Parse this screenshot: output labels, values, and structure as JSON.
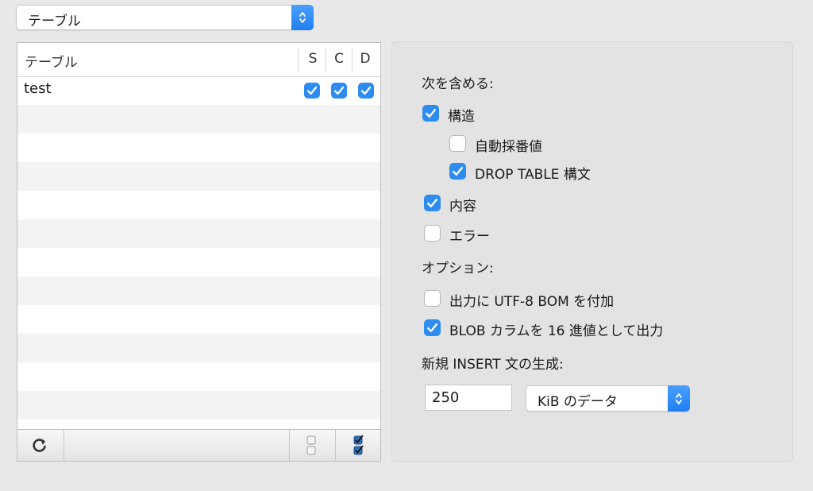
{
  "top_popup": {
    "selected": "テーブル"
  },
  "table": {
    "header_name": "テーブル",
    "col_s": "S",
    "col_c": "C",
    "col_d": "D",
    "rows": [
      {
        "name": "test",
        "s": true,
        "c": true,
        "d": true
      }
    ]
  },
  "options": {
    "include_heading": "次を含める:",
    "structure": "構造",
    "auto_increment": "自動採番値",
    "drop_table": "DROP TABLE 構文",
    "content": "内容",
    "errors": "エラー",
    "options_heading": "オプション:",
    "utf8_bom": "出力に UTF-8 BOM を付加",
    "blob_hex": "BLOB カラムを 16 進値として出力",
    "insert_heading": "新規 INSERT 文の生成:",
    "insert_size_value": "250",
    "unit_selected": "KiB のデータ"
  },
  "checkbox_states": {
    "structure": true,
    "auto_increment": false,
    "drop_table": true,
    "content": true,
    "errors": false,
    "utf8_bom": false,
    "blob_hex": true
  },
  "colors": {
    "accent": "#2d8cf0",
    "panel_bg": "#e3e3e3",
    "window_bg": "#e8e8e8"
  }
}
